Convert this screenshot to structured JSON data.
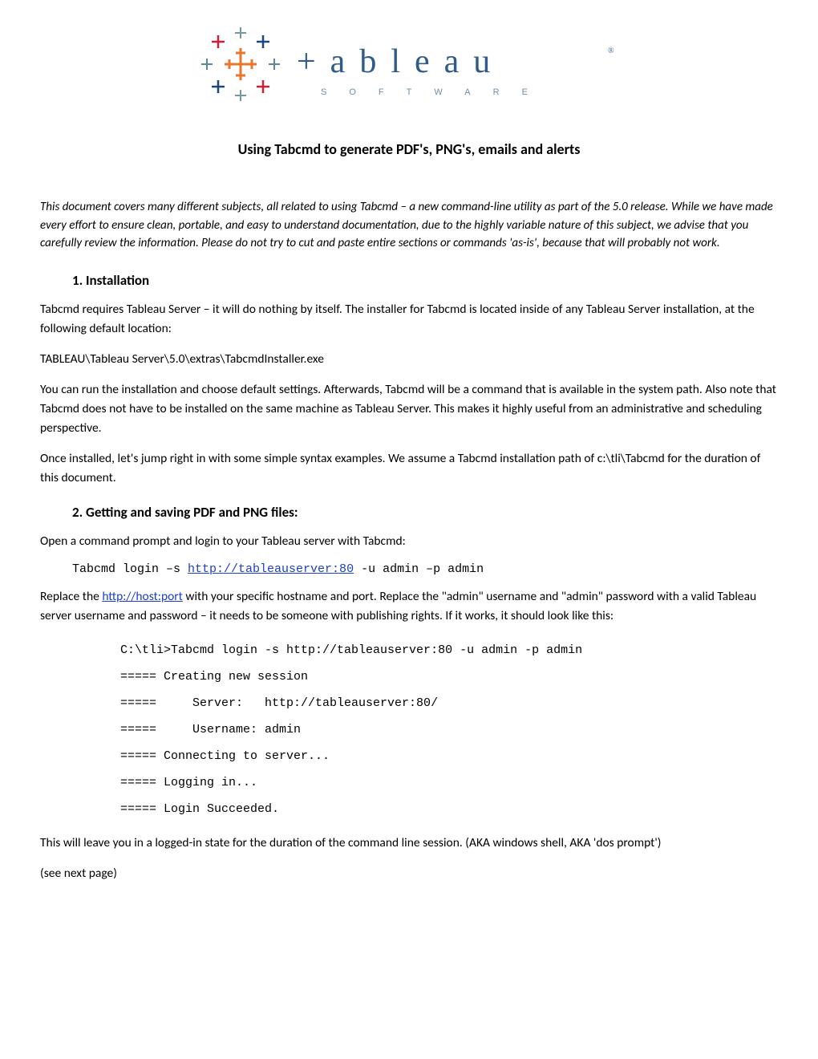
{
  "logo": {
    "word": "+ a b l e a u",
    "sub": "S   O   F   T   W   A   R   E"
  },
  "title": "Using Tabcmd to generate PDF's, PNG's, emails and alerts",
  "intro": "This document covers many different subjects, all related to using Tabcmd – a new command-line utility as part of the 5.0 release. While we have made every effort to ensure clean, portable, and easy to understand documentation, due to the highly variable nature of this subject, we advise that you carefully review the information. Please do not try to cut and paste entire sections or commands 'as-is', because that will probably not work.",
  "sec1": {
    "heading": "1.   Installation",
    "p1": "Tabcmd requires Tableau Server – it will do nothing by itself. The installer for Tabcmd is located inside of any Tableau Server installation, at the following default location:",
    "p2": "TABLEAU\\Tableau Server\\5.0\\extras\\TabcmdInstaller.exe",
    "p3": "You can run the installation and choose default settings. Afterwards, Tabcmd will be a command that is available in the system path. Also note that Tabcmd does not have to be installed on the same machine as Tableau Server. This makes it highly useful from an administrative and scheduling perspective.",
    "p4": "Once installed, let's jump right in with some simple syntax examples. We assume a Tabcmd installation path of c:\\tli\\Tabcmd for the duration of this document."
  },
  "sec2": {
    "heading": "2.   Getting and saving PDF and PNG files:",
    "p1": "Open a command prompt and login to your Tableau server with Tabcmd:",
    "cmd_pre": "Tabcmd login –s ",
    "cmd_link": "http://tableauserver:80",
    "cmd_post": " -u admin –p admin",
    "p2a": "Replace the ",
    "p2link": "http://host:port",
    "p2b": " with your specific hostname and port. Replace the \"admin\" username and \"admin\" password with a valid Tableau server username and password – it needs to be someone with publishing rights. If it works, it should look like this:",
    "console": "C:\\tli>Tabcmd login -s http://tableauserver:80 -u admin -p admin\n===== Creating new session\n=====     Server:   http://tableauserver:80/\n=====     Username: admin\n===== Connecting to server...\n===== Logging in...\n===== Login Succeeded.",
    "p3": "This will leave you in a logged-in state for the duration of the command line session. (AKA windows shell, AKA 'dos prompt')",
    "p4": "(see next page)"
  }
}
